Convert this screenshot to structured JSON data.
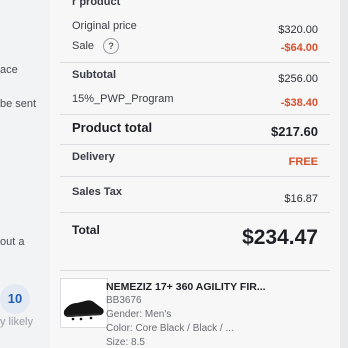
{
  "left": {
    "frag1": "ace",
    "frag2": "be sent",
    "frag3": "out a",
    "counter": "10",
    "frag4": "y likely"
  },
  "summary": {
    "header": "r product",
    "original_price_label": "Original price",
    "original_price_value": "$320.00",
    "sale_label": "Sale",
    "sale_value": "-$64.00",
    "subtotal_label": "Subtotal",
    "subtotal_value": "$256.00",
    "promo_label": "15%_PWP_Program",
    "promo_value": "-$38.40",
    "product_total_label": "Product total",
    "product_total_value": "$217.60",
    "delivery_label": "Delivery",
    "delivery_value": "FREE",
    "tax_label": "Sales Tax",
    "tax_value": "$16.87",
    "total_label": "Total",
    "total_value": "$234.47"
  },
  "product": {
    "name": "NEMEZIZ 17+ 360 AGILITY FIR...",
    "sku": "BB3676",
    "gender": "Gender: Men's",
    "color": "Color: Core Black / Black / ...",
    "size": "Size: 8.5"
  },
  "icons": {
    "help": "question-icon",
    "shoe": "shoe-thumbnail"
  }
}
